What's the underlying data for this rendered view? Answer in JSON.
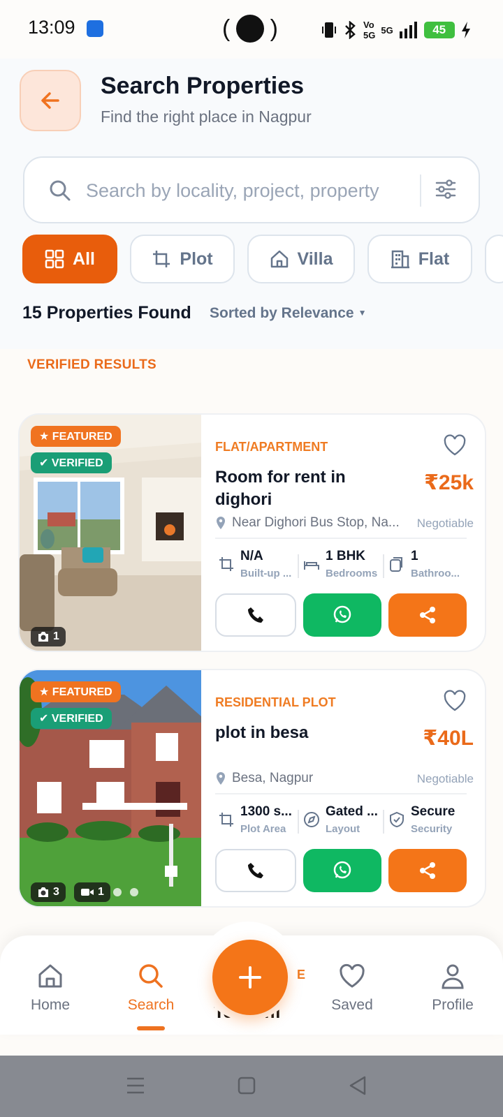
{
  "status_bar": {
    "time": "13:09",
    "battery": "45",
    "network": "5G"
  },
  "header": {
    "title": "Search Properties",
    "subtitle": "Find the right place in Nagpur"
  },
  "search": {
    "placeholder": "Search by locality, project, property",
    "value": ""
  },
  "filters": [
    {
      "label": "All",
      "icon": "grid-icon",
      "active": true
    },
    {
      "label": "Plot",
      "icon": "crop-icon",
      "active": false
    },
    {
      "label": "Villa",
      "icon": "house-icon",
      "active": false
    },
    {
      "label": "Flat",
      "icon": "building-icon",
      "active": false
    }
  ],
  "results": {
    "count_text": "15 Properties Found",
    "sort_text": "Sorted by Relevance",
    "section_label": "VERIFIED RESULTS"
  },
  "listings": [
    {
      "featured": "★ FEATURED",
      "verified": "✔ VERIFIED",
      "photos": "1",
      "type": "FLAT/APARTMENT",
      "title": "Room for rent in dighori",
      "price": "₹25k",
      "location": "Near Dighori Bus Stop, Na...",
      "negotiable": "Negotiable",
      "specs": [
        {
          "value": "N/A",
          "label": "Built-up ...",
          "icon": "area-icon"
        },
        {
          "value": "1 BHK",
          "label": "Bedrooms",
          "icon": "bed-icon"
        },
        {
          "value": "1",
          "label": "Bathroo...",
          "icon": "bath-icon"
        }
      ]
    },
    {
      "featured": "★ FEATURED",
      "verified": "✔ VERIFIED",
      "photos": "3",
      "videos": "1",
      "type": "RESIDENTIAL PLOT",
      "title": "plot in besa",
      "price": "₹40L",
      "location": "Besa, Nagpur",
      "negotiable": "Negotiable",
      "specs": [
        {
          "value": "1300 s...",
          "label": "Plot Area",
          "icon": "area-icon"
        },
        {
          "value": "Gated ...",
          "label": "Layout",
          "icon": "compass-icon"
        },
        {
          "value": "Secure",
          "label": "Security",
          "icon": "shield-icon"
        }
      ]
    }
  ],
  "peek": {
    "type": "CE",
    "title": "Test offi"
  },
  "bottom_nav": [
    {
      "label": "Home",
      "icon": "home-icon",
      "active": false
    },
    {
      "label": "Search",
      "icon": "search-icon",
      "active": true
    },
    {
      "label": "Saved",
      "icon": "heart-icon",
      "active": false
    },
    {
      "label": "Profile",
      "icon": "user-icon",
      "active": false
    }
  ],
  "colors": {
    "accent": "#e85d0c",
    "price": "#ea6a1a",
    "verified": "#1a9e76",
    "whatsapp": "#0fb862",
    "share": "#f47518"
  }
}
